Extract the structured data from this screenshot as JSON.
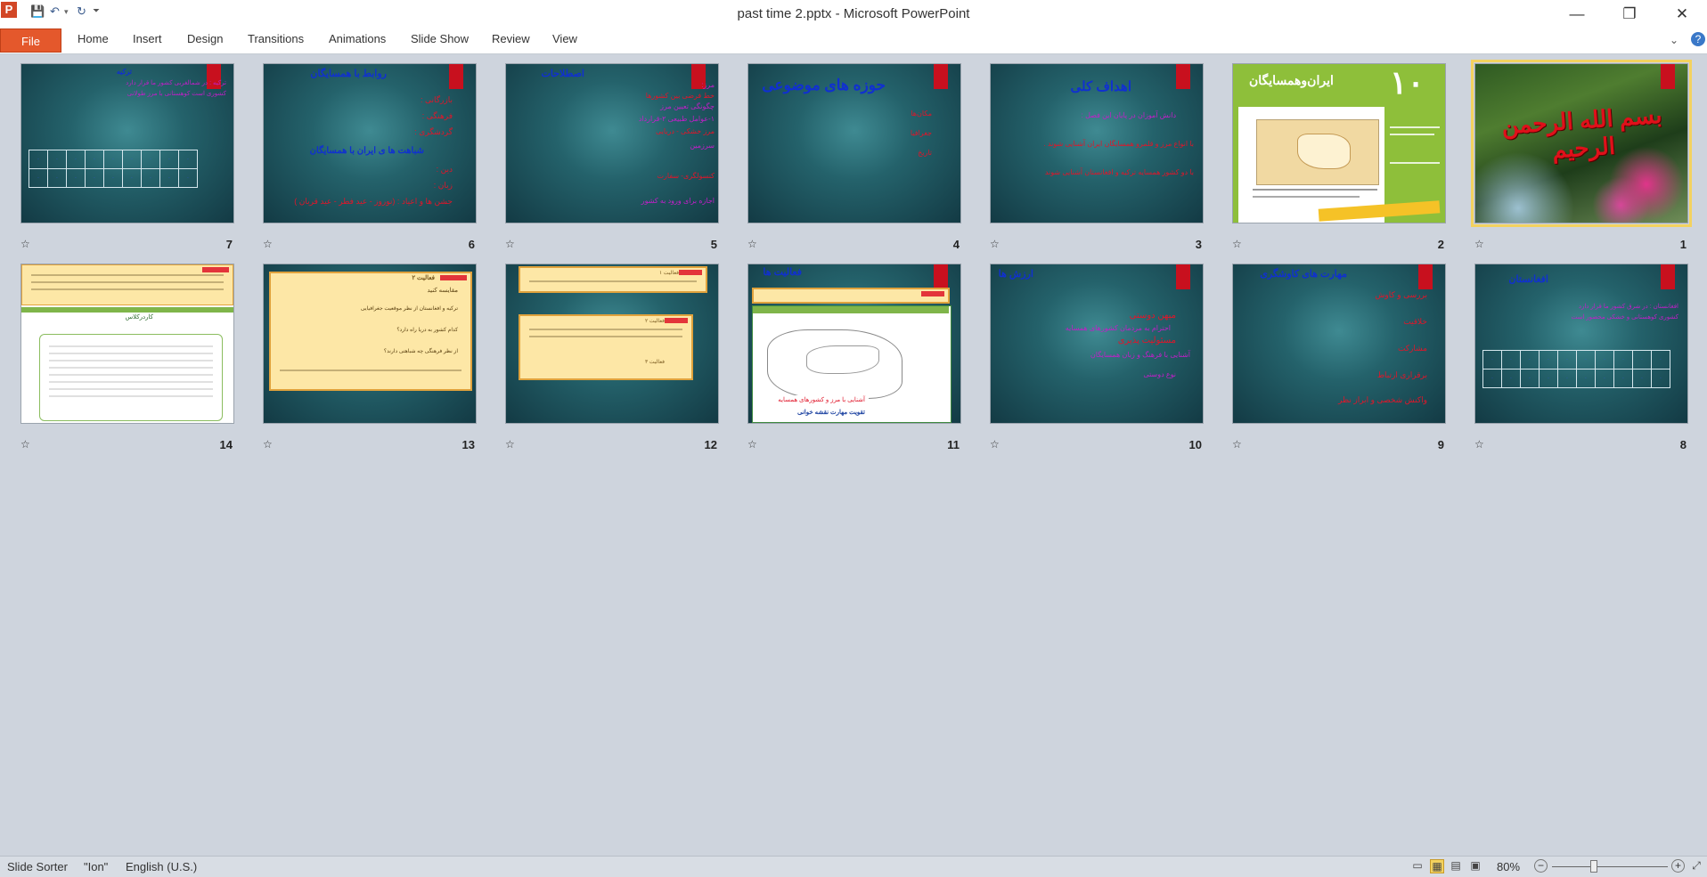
{
  "window": {
    "title": "past time 2.pptx - Microsoft PowerPoint",
    "app_icon_letter": "P",
    "controls": {
      "minimize": "—",
      "restore": "❐",
      "close": "✕"
    }
  },
  "quick_access": [
    "save-icon",
    "undo-icon",
    "redo-icon",
    "customize-icon"
  ],
  "ribbon": {
    "file_label": "File",
    "tabs": [
      "Home",
      "Insert",
      "Design",
      "Transitions",
      "Animations",
      "Slide Show",
      "Review",
      "View"
    ]
  },
  "slides": [
    {
      "number": "1",
      "title": "بسم الله الرحمن الرحیم",
      "selected": true
    },
    {
      "number": "2",
      "title": "ایران‌وهمسایگان",
      "badge": "۱۰"
    },
    {
      "number": "3",
      "title": "اهداف کلی",
      "lines": [
        "دانش آموزان در پایان این فصل :",
        "با انواع مرز و قلمرو همسایگان ایران آشنایی شوند .",
        "با دو کشور همسایه ترکیه و افغانستان آشنایی شوند"
      ]
    },
    {
      "number": "4",
      "title": "حوزه های موضوعی",
      "lines": [
        "مکان‌ها",
        "جغرافیا",
        "تاریخ"
      ]
    },
    {
      "number": "5",
      "title": "اصطلاحات",
      "lines": [
        "مرز:",
        "خط فرضی بین کشورها",
        "چگونگی تعیین مرز",
        "۱-عوامل طبیعی ۲-قرارداد",
        "مرز خشکی - دریایی",
        "سرزمین",
        "کنسولگری- سفارت",
        "اجازه برای ورود به کشور"
      ]
    },
    {
      "number": "6",
      "title": "روابط با همسایگان",
      "lines": [
        "بازرگانی :",
        "فرهنگی :",
        "گردشگری :",
        "شباهت ها ی ایران با همسایگان",
        "دین :",
        "زبان :",
        "جشن ها و اعیاد : (نوروز - عید فطر - عید قربان )"
      ]
    },
    {
      "number": "7",
      "title": "ترکیه",
      "lines": [
        "ترکیه : در شمالغربی کشور ما قرار دارد",
        "کشوری است کوهستانی با مرز طولانی"
      ]
    },
    {
      "number": "8",
      "title": "افغانستان",
      "lines": [
        "افغانستان : در شرق کشور ما قرار دارد",
        "کشوری کوهستانی و خشکی محصور است"
      ]
    },
    {
      "number": "9",
      "title": "مهارت های کاوشگری",
      "lines": [
        "بررسی و کاوش",
        "خلاقیت",
        "مشارکت",
        "برقراری ارتباط",
        "واکنش شخصی و ابراز نظر"
      ]
    },
    {
      "number": "10",
      "title": "ارزش ها",
      "lines": [
        "میهن دوستی",
        "احترام به مردمان کشورهای همسایه",
        "مسئولیت پذیری",
        "آشنایی با فرهنگ و زبان همسایگان",
        "نوع دوستی"
      ]
    },
    {
      "number": "11",
      "title": "فعالیت ها",
      "lines": [
        "آشنایی با مرز و کشورهای همسایه",
        "تقویت مهارت نقشه خوانی"
      ]
    },
    {
      "number": "12",
      "title": "",
      "lines": [
        "فعالیت ۱",
        "فعالیت ۲",
        "فعالیت ۳"
      ]
    },
    {
      "number": "13",
      "title": "",
      "lines": [
        "فعالیت ۲",
        "مقایسه کنید",
        "ترکیه و افغانستان از نظر موقعیت جغرافیایی",
        "کدام کشور به دریا راه دارد؟",
        "از نظر فرهنگی چه شباهتی دارند؟"
      ]
    },
    {
      "number": "14",
      "title": "",
      "lines": [
        "کاردرکلاس"
      ]
    }
  ],
  "status": {
    "view_name": "Slide Sorter",
    "theme": "\"Ion\"",
    "language": "English (U.S.)",
    "zoom": "80%",
    "zoom_level_percent": 80
  }
}
